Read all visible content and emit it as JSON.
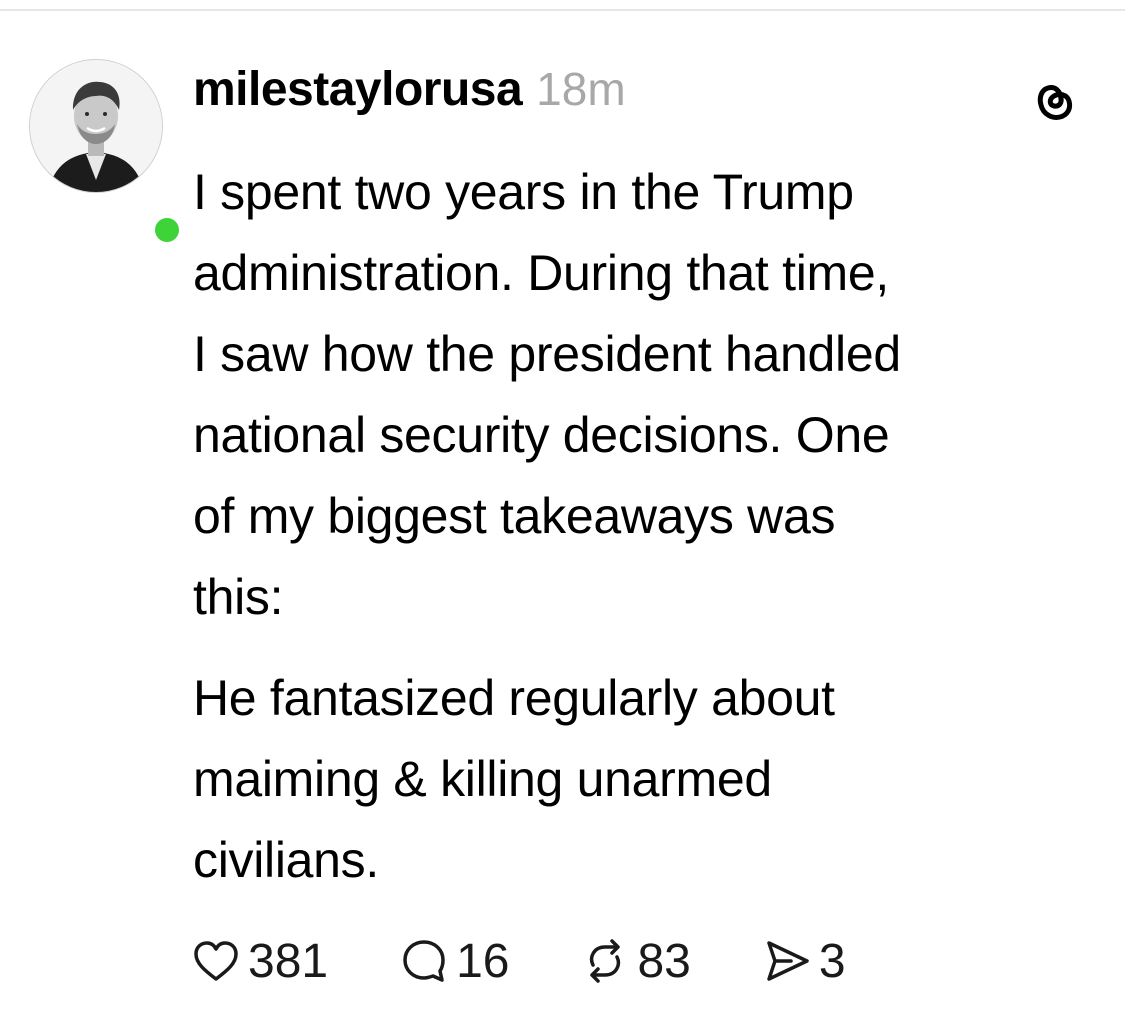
{
  "post": {
    "username": "milestaylorusa",
    "timestamp": "18m",
    "paragraphs": [
      "I spent two years in the Trump\nadministration. During that time,\nI saw how the president handled\nnational security decisions. One\nof my biggest takeaways was\nthis:",
      "He fantasized regularly about\nmaiming & killing unarmed\ncivilians."
    ],
    "actions": {
      "likes": "381",
      "replies": "16",
      "reposts": "83",
      "shares": "3"
    }
  },
  "icons": {
    "threads": "threads-logo-icon",
    "like": "heart-icon",
    "reply": "speech-bubble-icon",
    "repost": "repost-arrows-icon",
    "share": "send-paper-plane-icon"
  },
  "colors": {
    "online": "#3fd33a",
    "timestamp": "#a8a8a8",
    "text": "#000000"
  }
}
